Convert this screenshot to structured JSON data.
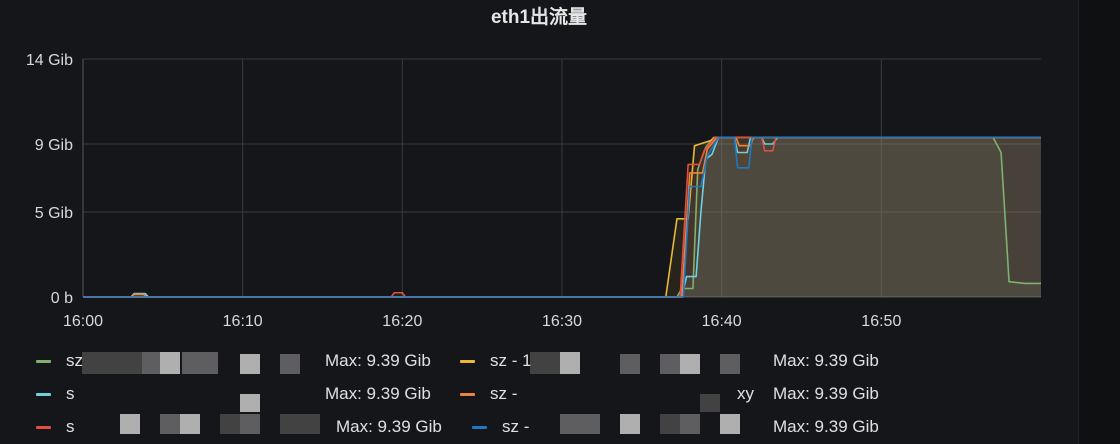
{
  "panel": {
    "title": "eth1出流量"
  },
  "chart_data": {
    "type": "area",
    "title": "eth1出流量",
    "xlabel": "",
    "ylabel": "",
    "x_ticks": [
      "16:00",
      "16:10",
      "16:20",
      "16:30",
      "16:40",
      "16:50"
    ],
    "y_ticks": [
      "0 b",
      "5 Gib",
      "9 Gib",
      "14 Gib"
    ],
    "y_tick_values": [
      0,
      5,
      9,
      14
    ],
    "xlim": [
      0,
      60
    ],
    "ylim": [
      0,
      14
    ],
    "grid": true,
    "legend_position": "bottom",
    "series": [
      {
        "color": "#7eb26d",
        "points": [
          [
            0,
            0
          ],
          [
            37.2,
            0
          ],
          [
            37.5,
            0.5
          ],
          [
            38.2,
            0.5
          ],
          [
            38.5,
            7.5
          ],
          [
            39.0,
            8.8
          ],
          [
            39.5,
            9.39
          ],
          [
            42,
            9.39
          ],
          [
            57,
            9.39
          ],
          [
            57.5,
            8.5
          ],
          [
            58,
            0.9
          ],
          [
            59,
            0.8
          ],
          [
            60,
            0.8
          ]
        ]
      },
      {
        "color": "#eab839",
        "points": [
          [
            0,
            0
          ],
          [
            36.5,
            0
          ],
          [
            37.2,
            4.6
          ],
          [
            37.9,
            4.6
          ],
          [
            38.3,
            8.9
          ],
          [
            39.3,
            9.2
          ],
          [
            39.6,
            9.39
          ],
          [
            60,
            9.39
          ]
        ]
      },
      {
        "color": "#6ed0e0",
        "points": [
          [
            0,
            0
          ],
          [
            3,
            0
          ],
          [
            3.2,
            0.2
          ],
          [
            3.9,
            0.2
          ],
          [
            4.1,
            0
          ],
          [
            37.5,
            0
          ],
          [
            37.8,
            1.2
          ],
          [
            38.4,
            1.2
          ],
          [
            38.7,
            5.0
          ],
          [
            39.0,
            8.1
          ],
          [
            39.4,
            8.4
          ],
          [
            39.8,
            9.39
          ],
          [
            40.8,
            9.39
          ],
          [
            41.0,
            8.5
          ],
          [
            41.6,
            8.5
          ],
          [
            41.8,
            9.39
          ],
          [
            42.5,
            9.39
          ],
          [
            42.7,
            9.0
          ],
          [
            43.2,
            9.0
          ],
          [
            43.5,
            9.39
          ],
          [
            60,
            9.39
          ]
        ]
      },
      {
        "color": "#ef843c",
        "points": [
          [
            0,
            0
          ],
          [
            3,
            0
          ],
          [
            3.2,
            0.15
          ],
          [
            3.8,
            0.15
          ],
          [
            4.0,
            0
          ],
          [
            37.5,
            0
          ],
          [
            38.0,
            7.3
          ],
          [
            38.8,
            7.3
          ],
          [
            39.1,
            8.7
          ],
          [
            39.7,
            9.39
          ],
          [
            40.9,
            9.39
          ],
          [
            41.1,
            8.9
          ],
          [
            41.8,
            8.9
          ],
          [
            42.0,
            9.39
          ],
          [
            60,
            9.39
          ]
        ]
      },
      {
        "color": "#e24d42",
        "points": [
          [
            0,
            0
          ],
          [
            19.3,
            0
          ],
          [
            19.5,
            0.25
          ],
          [
            20.0,
            0.25
          ],
          [
            20.2,
            0
          ],
          [
            37.4,
            0
          ],
          [
            37.9,
            7.8
          ],
          [
            38.6,
            7.8
          ],
          [
            38.9,
            8.6
          ],
          [
            39.6,
            9.39
          ],
          [
            42.5,
            9.39
          ],
          [
            42.7,
            8.6
          ],
          [
            43.2,
            8.6
          ],
          [
            43.4,
            9.39
          ],
          [
            60,
            9.39
          ]
        ]
      },
      {
        "color": "#1f78c1",
        "points": [
          [
            0,
            0
          ],
          [
            37.6,
            0
          ],
          [
            38.0,
            6.5
          ],
          [
            38.7,
            6.5
          ],
          [
            39.1,
            8.3
          ],
          [
            39.8,
            9.39
          ],
          [
            40.8,
            9.39
          ],
          [
            41.0,
            7.6
          ],
          [
            41.7,
            7.6
          ],
          [
            41.9,
            9.39
          ],
          [
            60,
            9.39
          ]
        ]
      }
    ]
  },
  "legend": [
    {
      "name": "sz",
      "max": "Max: 9.39 Gib",
      "color": "#7eb26d"
    },
    {
      "name": "sz - 1",
      "max": "Max: 9.39 Gib",
      "color": "#eab839"
    },
    {
      "name": "s",
      "max": "Max: 9.39 Gib",
      "color": "#6ed0e0"
    },
    {
      "name": "sz -",
      "suffix": "xy",
      "max": "Max: 9.39 Gib",
      "color": "#ef843c"
    },
    {
      "name": "s",
      "max": "Max: 9.39 Gib",
      "color": "#e24d42"
    },
    {
      "name": "sz -",
      "max": "Max: 9.39 Gib",
      "color": "#1f78c1"
    }
  ]
}
